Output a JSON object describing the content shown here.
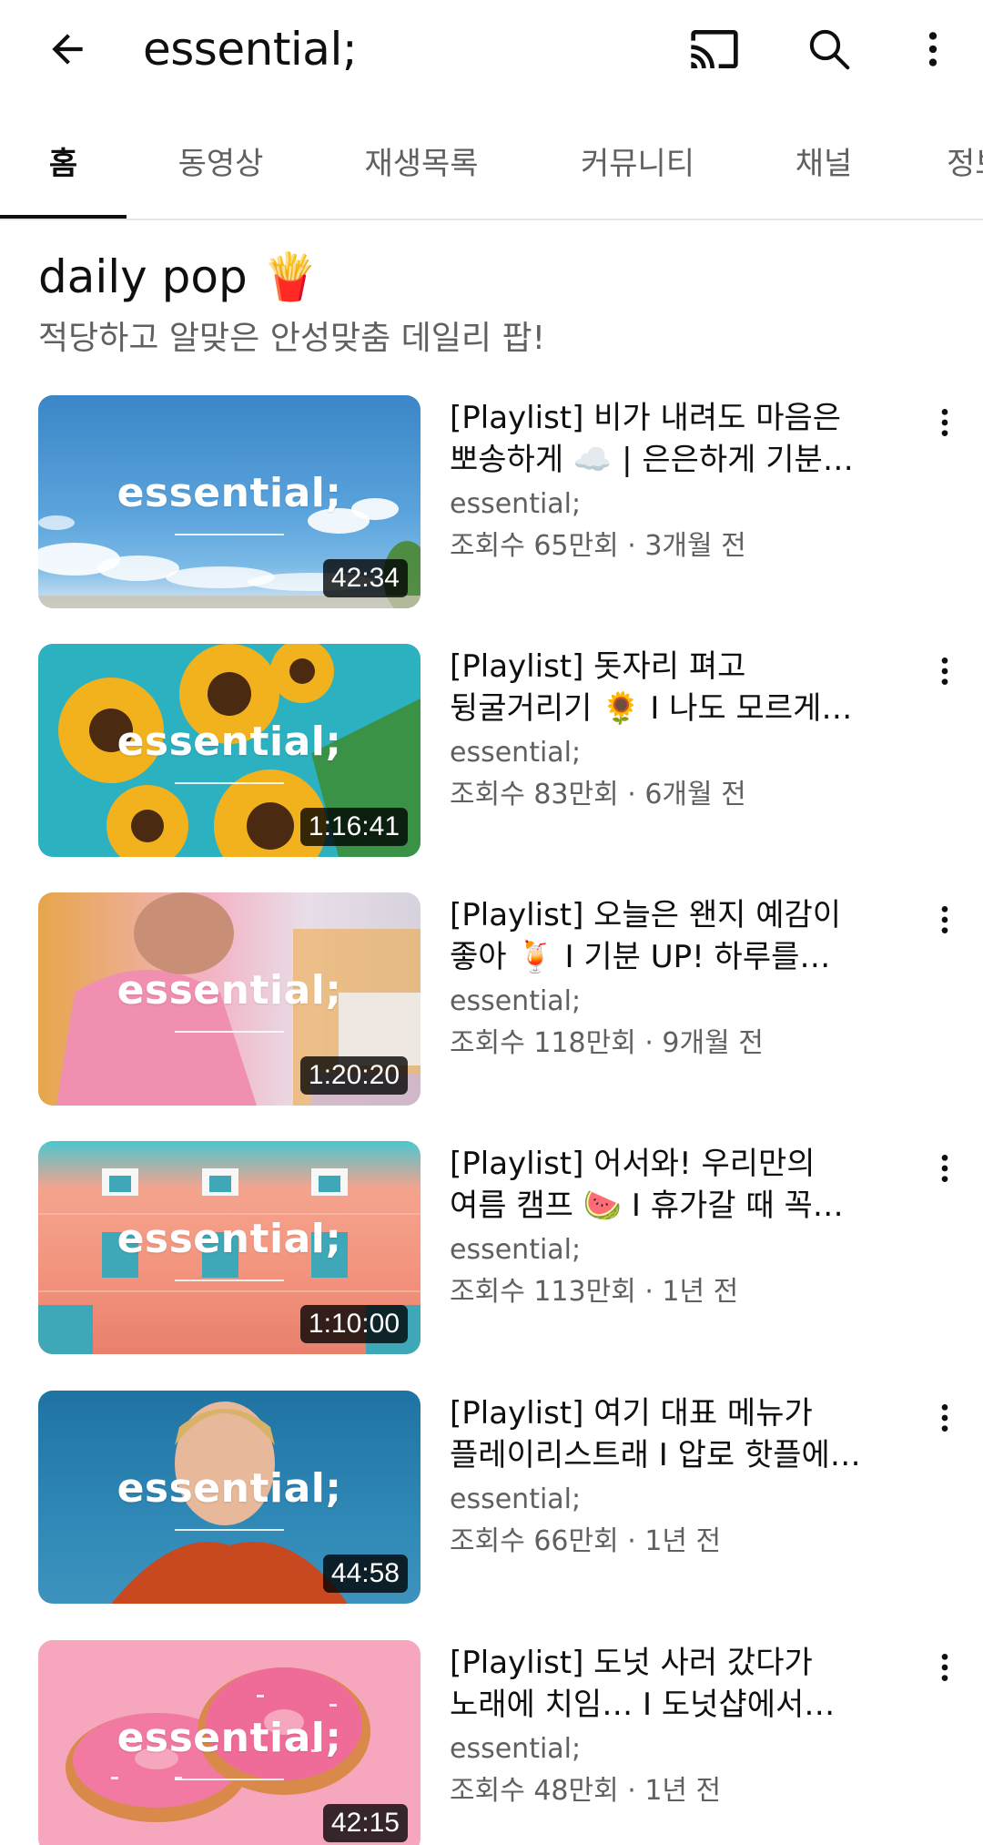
{
  "header": {
    "title": "essential;"
  },
  "tabs": [
    {
      "label": "홈"
    },
    {
      "label": "동영상"
    },
    {
      "label": "재생목록"
    },
    {
      "label": "커뮤니티"
    },
    {
      "label": "채널"
    },
    {
      "label": "정보"
    }
  ],
  "section": {
    "title": "daily pop 🍟",
    "subtitle": "적당하고 알맞은 안성맞춤 데일리 팝!"
  },
  "videos": [
    {
      "title_line1": "[Playlist] 비가 내려도 마음은",
      "title_line2": "뽀송하게 ☁️ | 은은하게 기분…",
      "thumb_text": "essential;",
      "duration": "42:34",
      "channel": "essential;",
      "meta": "조회수 65만회 · 3개월 전"
    },
    {
      "title_line1": "[Playlist] 돗자리 펴고",
      "title_line2": "뒹굴거리기 🌻 I 나도 모르게…",
      "thumb_text": "essential;",
      "duration": "1:16:41",
      "channel": "essential;",
      "meta": "조회수 83만회 · 6개월 전"
    },
    {
      "title_line1": "[Playlist] 오늘은 왠지 예감이",
      "title_line2": "좋아 🍹 I 기분 UP! 하루를…",
      "thumb_text": "essential;",
      "duration": "1:20:20",
      "channel": "essential;",
      "meta": "조회수 118만회 · 9개월 전"
    },
    {
      "title_line1": "[Playlist] 어서와! 우리만의",
      "title_line2": "여름 캠프 🍉 I 휴가갈 때 꼭…",
      "thumb_text": "essential;",
      "duration": "1:10:00",
      "channel": "essential;",
      "meta": "조회수 113만회 · 1년 전"
    },
    {
      "title_line1": "[Playlist] 여기 대표 메뉴가",
      "title_line2": "플레이리스트래 I 압로 핫플에…",
      "thumb_text": "essential;",
      "duration": "44:58",
      "channel": "essential;",
      "meta": "조회수 66만회 · 1년 전"
    },
    {
      "title_line1": "[Playlist] 도넛 사러 갔다가",
      "title_line2": "노래에 치임… I 도넛샵에서…",
      "thumb_text": "essential;",
      "duration": "42:15",
      "channel": "essential;",
      "meta": "조회수 48만회 · 1년 전"
    }
  ],
  "icons": {
    "back": "arrow-left-icon",
    "cast": "cast-icon",
    "search": "search-icon",
    "more": "more-vert-icon"
  },
  "colors": {
    "text_primary": "#0f0f0f",
    "text_secondary": "#606060",
    "divider": "#e5e5e5",
    "background": "#ffffff"
  }
}
